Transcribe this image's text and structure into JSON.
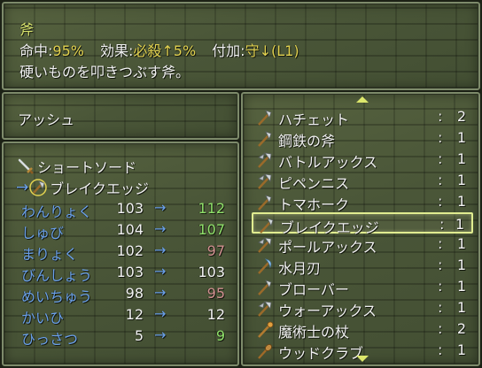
{
  "top": {
    "item_name": "斧",
    "hit_label": "命中:",
    "hit_value": "95%",
    "effect_label": "効果:",
    "effect_value": "必殺↑5%",
    "attach_label": "付加:",
    "attach_value": "守↓(L1)",
    "description": "硬いものを叩きつぶす斧。"
  },
  "character": {
    "name": "アッシュ"
  },
  "compare": {
    "current_weapon": {
      "name": "ショートソード",
      "icon": "sword-icon"
    },
    "new_weapon": {
      "arrow": "→",
      "name": "ブレイクエッジ",
      "icon": "axe-icon"
    },
    "stats": [
      {
        "name": "わんりょく",
        "old": "103",
        "arrow": "→",
        "new": "112",
        "trend": "up"
      },
      {
        "name": "しゅび",
        "old": "104",
        "arrow": "→",
        "new": "107",
        "trend": "up"
      },
      {
        "name": "まりょく",
        "old": "102",
        "arrow": "→",
        "new": "97",
        "trend": "down"
      },
      {
        "name": "びんしょう",
        "old": "103",
        "arrow": "→",
        "new": "103",
        "trend": "same"
      },
      {
        "name": "めいちゅう",
        "old": "98",
        "arrow": "→",
        "new": "95",
        "trend": "down"
      },
      {
        "name": "かいひ",
        "old": "12",
        "arrow": "→",
        "new": "12",
        "trend": "same"
      },
      {
        "name": "ひっさつ",
        "old": "5",
        "arrow": "→",
        "new": "9",
        "trend": "up"
      }
    ]
  },
  "inventory": {
    "colon": ":",
    "items": [
      {
        "name": "ハチェット",
        "count": "2",
        "icon": "axe-icon"
      },
      {
        "name": "鋼鉄の斧",
        "count": "1",
        "icon": "axe-icon"
      },
      {
        "name": "バトルアックス",
        "count": "1",
        "icon": "double-axe-icon"
      },
      {
        "name": "ピペンニス",
        "count": "1",
        "icon": "double-axe-icon"
      },
      {
        "name": "トマホーク",
        "count": "1",
        "icon": "axe-icon"
      },
      {
        "name": "ブレイクエッジ",
        "count": "1",
        "icon": "axe-icon",
        "selected": true
      },
      {
        "name": "ポールアックス",
        "count": "1",
        "icon": "double-axe-icon"
      },
      {
        "name": "水月刃",
        "count": "1",
        "icon": "crescent-axe-icon"
      },
      {
        "name": "ブローバー",
        "count": "1",
        "icon": "axe-icon"
      },
      {
        "name": "ウォーアックス",
        "count": "1",
        "icon": "double-axe-icon"
      },
      {
        "name": "魔術士の杖",
        "count": "2",
        "icon": "staff-icon"
      },
      {
        "name": "ウッドクラブ",
        "count": "1",
        "icon": "club-icon"
      }
    ]
  },
  "colors": {
    "highlight": "#d9e36d",
    "stat_blue": "#6aa0ea",
    "up": "#8fe06a",
    "down": "#d09090"
  }
}
